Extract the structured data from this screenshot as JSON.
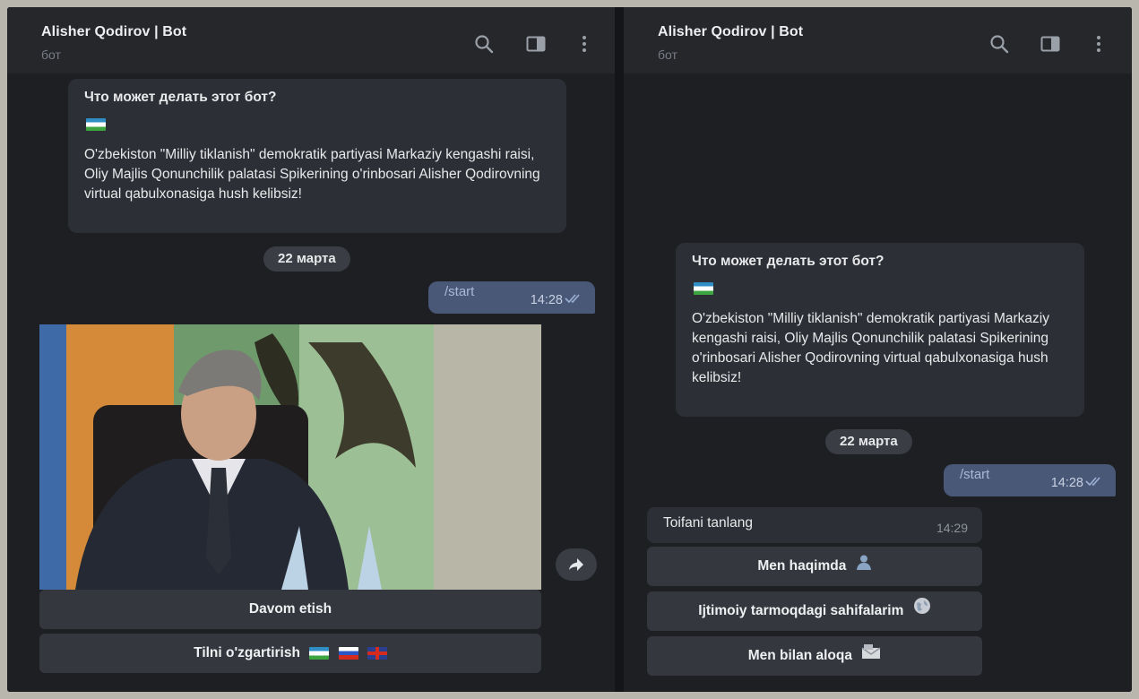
{
  "left": {
    "header": {
      "title": "Alisher Qodirov | Bot",
      "subtitle": "бот"
    },
    "intro": {
      "title": "Что может делать этот бот?",
      "body": "O'zbekiston \"Milliy tiklanish\" demokratik partiyasi Markaziy kengashi raisi, Oliy Majlis Qonunchilik palatasi Spikerining o'rinbosari Alisher Qodirovning virtual qabulxonasiga hush kelibsiz!"
    },
    "date": "22 марта",
    "outgoing": {
      "text": "/start",
      "time": "14:28"
    },
    "buttons": {
      "continue": "Davom etish",
      "change_language": "Tilni o'zgartirish"
    }
  },
  "right": {
    "header": {
      "title": "Alisher Qodirov | Bot",
      "subtitle": "бот"
    },
    "intro": {
      "title": "Что может делать этот бот?",
      "body": "O'zbekiston \"Milliy tiklanish\" demokratik partiyasi Markaziy kengashi raisi, Oliy Majlis Qonunchilik palatasi Spikerining o'rinbosari Alisher Qodirovning virtual qabulxonasiga hush kelibsiz!"
    },
    "date": "22 марта",
    "outgoing": {
      "text": "/start",
      "time": "14:28"
    },
    "incoming": {
      "text": "Toifani tanlang",
      "time": "14:29"
    },
    "buttons": {
      "about_me": "Men haqimda",
      "social_pages": "Ijtimoiy tarmoqdagi sahifalarim",
      "contact_me": "Men bilan aloqa"
    }
  },
  "icons": [
    "search-icon",
    "sidebar-toggle-icon",
    "more-vertical-icon",
    "share-icon",
    "user-icon",
    "globe-icon",
    "envelope-icon",
    "double-check-icon",
    "uz-flag",
    "ru-flag",
    "gb-flag"
  ],
  "colors": {
    "background": "#1d1f23",
    "header": "#25272b",
    "bubble": "#2c2f35",
    "outgoing": "#4a5878",
    "button": "#34373d"
  }
}
